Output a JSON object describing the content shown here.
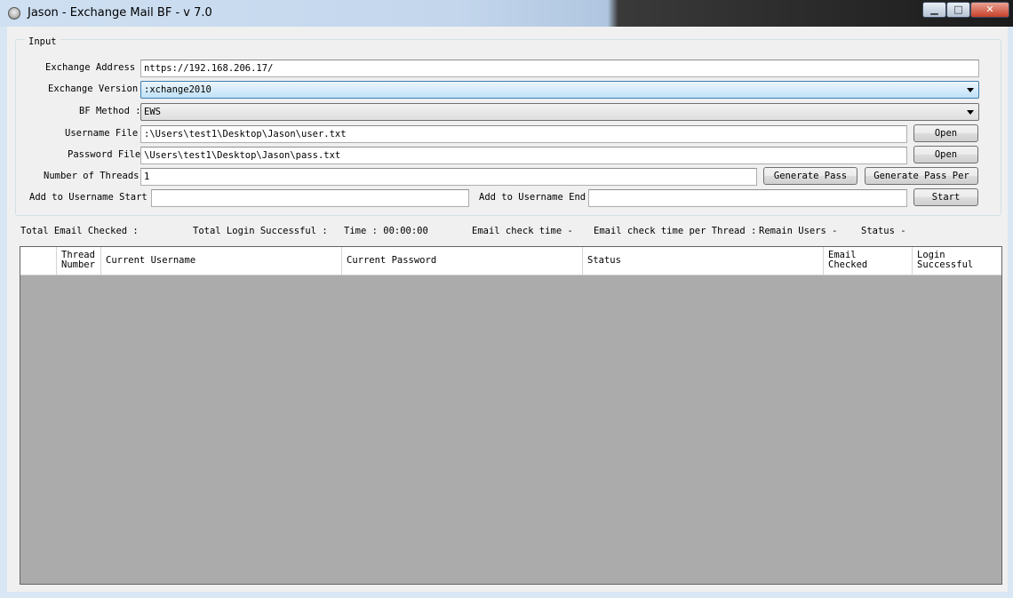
{
  "window": {
    "title": "Jason - Exchange Mail BF - v 7.0",
    "minimize_glyph": "▁",
    "maximize_glyph": "□",
    "close_glyph": "✕"
  },
  "input": {
    "group_label": "Input",
    "exchange_address": {
      "label": "Exchange Address :",
      "value": "nttps://192.168.206.17/"
    },
    "exchange_version": {
      "label": "Exchange Version :",
      "value": ":xchange2010"
    },
    "bf_method": {
      "label": "BF Method :",
      "value": "EWS"
    },
    "username_file": {
      "label": "Username File :",
      "value": ":\\Users\\test1\\Desktop\\Jason\\user.txt",
      "button": "Open"
    },
    "password_file": {
      "label": "Password File :",
      "value": "\\Users\\test1\\Desktop\\Jason\\pass.txt",
      "button": "Open"
    },
    "threads": {
      "label": "Number of Threads :",
      "value": "1"
    },
    "generate_pass_button": "Generate Pass",
    "generate_pass_per_button": "Generate Pass Per",
    "username_start": {
      "label": "Add to Username Start :",
      "value": ""
    },
    "username_end": {
      "label": "Add to Username End :",
      "value": ""
    },
    "start_button": "Start"
  },
  "stats": {
    "total_email_checked": "Total Email Checked :",
    "total_login_successful": "Total Login Successful :",
    "time": "Time : 00:00:00",
    "email_check_time": "Email check time -",
    "email_check_time_per_thread": "Email check time per Thread :",
    "remain_users": "Remain Users -",
    "status": "Status -"
  },
  "grid": {
    "columns": [
      {
        "label": ""
      },
      {
        "label": "Thread\nNumber"
      },
      {
        "label": "Current Username"
      },
      {
        "label": "Current Password"
      },
      {
        "label": "Status"
      },
      {
        "label": "Email\nChecked"
      },
      {
        "label": "Login\nSuccessful"
      }
    ]
  }
}
